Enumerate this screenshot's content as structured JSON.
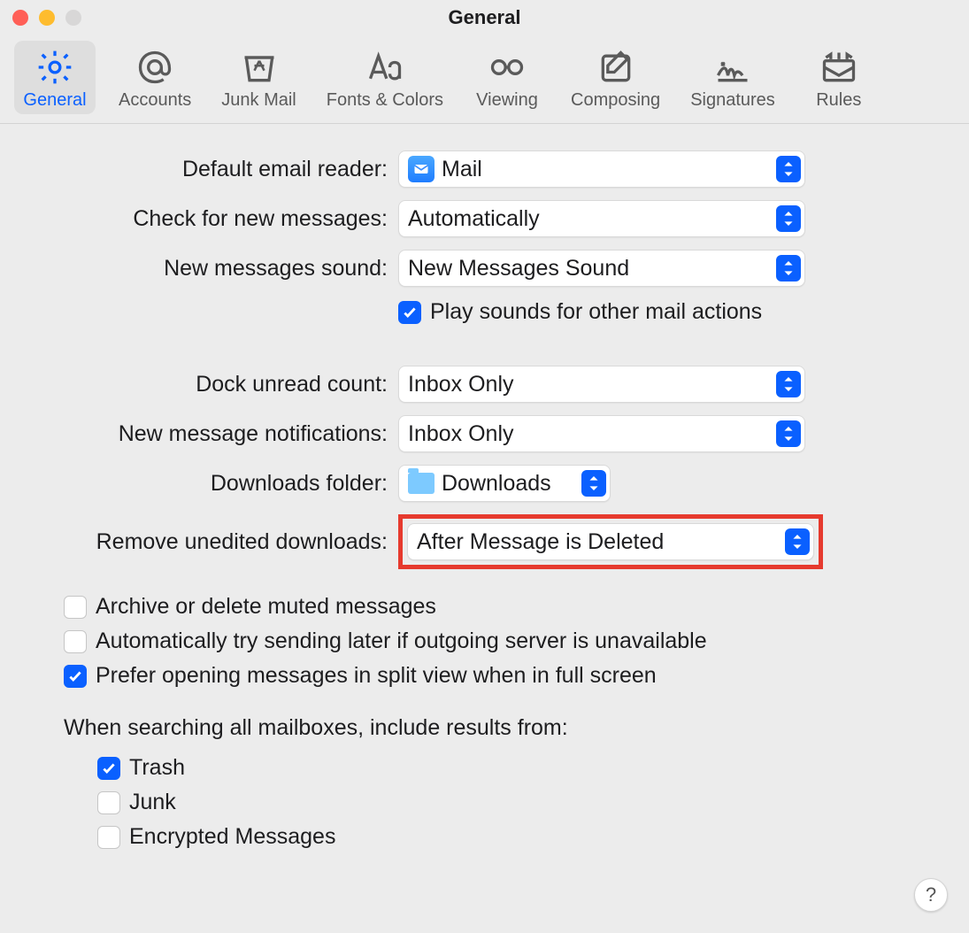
{
  "window": {
    "title": "General"
  },
  "toolbar": [
    {
      "key": "general",
      "label": "General",
      "active": true
    },
    {
      "key": "accounts",
      "label": "Accounts",
      "active": false
    },
    {
      "key": "junk",
      "label": "Junk Mail",
      "active": false
    },
    {
      "key": "fonts",
      "label": "Fonts & Colors",
      "active": false
    },
    {
      "key": "viewing",
      "label": "Viewing",
      "active": false
    },
    {
      "key": "composing",
      "label": "Composing",
      "active": false
    },
    {
      "key": "signatures",
      "label": "Signatures",
      "active": false
    },
    {
      "key": "rules",
      "label": "Rules",
      "active": false
    }
  ],
  "labels": {
    "default_reader": "Default email reader:",
    "check_new": "Check for new messages:",
    "new_sound": "New messages sound:",
    "play_sounds": "Play sounds for other mail actions",
    "dock_unread": "Dock unread count:",
    "new_notifications": "New message notifications:",
    "downloads_folder": "Downloads folder:",
    "remove_unedited": "Remove unedited downloads:",
    "archive_muted": "Archive or delete muted messages",
    "auto_send_later": "Automatically try sending later if outgoing server is unavailable",
    "prefer_split": "Prefer opening messages in split view when in full screen",
    "search_heading": "When searching all mailboxes, include results from:",
    "trash": "Trash",
    "junk": "Junk",
    "encrypted": "Encrypted Messages"
  },
  "values": {
    "default_reader": "Mail",
    "check_new": "Automatically",
    "new_sound": "New Messages Sound",
    "dock_unread": "Inbox Only",
    "new_notifications": "Inbox Only",
    "downloads_folder": "Downloads",
    "remove_unedited": "After Message is Deleted"
  },
  "checks": {
    "play_sounds": true,
    "archive_muted": false,
    "auto_send_later": false,
    "prefer_split": true,
    "trash": true,
    "junk": false,
    "encrypted": false
  },
  "help": "?"
}
